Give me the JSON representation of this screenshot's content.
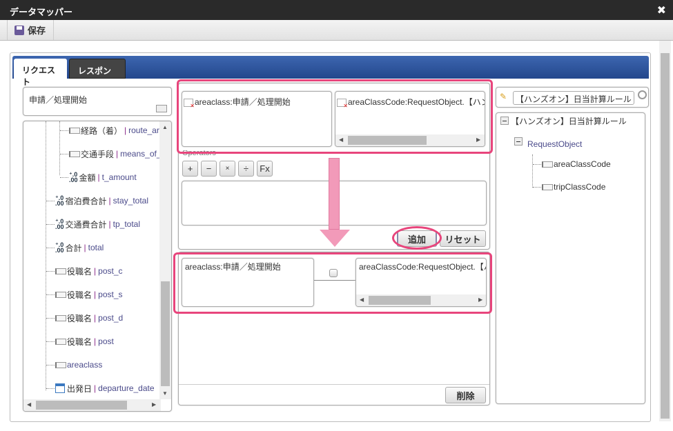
{
  "window": {
    "title": "データマッパー",
    "close_icon": "close-icon"
  },
  "toolbar": {
    "save_label": "保存"
  },
  "tabs": [
    {
      "label": "リクエスト",
      "active": true
    },
    {
      "label": "レスポンス",
      "active": false
    }
  ],
  "left": {
    "search_value": "申請／処理開始",
    "tree": [
      {
        "jp": "経路（着）",
        "en": "route_arrival",
        "icon": "field"
      },
      {
        "jp": "交通手段",
        "en": "means_of_",
        "icon": "field"
      },
      {
        "jp": "金額",
        "en": "t_amount",
        "icon": "number"
      },
      {
        "jp": "宿泊費合計",
        "en": "stay_total",
        "icon": "number"
      },
      {
        "jp": "交通費合計",
        "en": "tp_total",
        "icon": "number"
      },
      {
        "jp": "合計",
        "en": "total",
        "icon": "number"
      },
      {
        "jp": "役職名",
        "en": "post_c",
        "icon": "field"
      },
      {
        "jp": "役職名",
        "en": "post_s",
        "icon": "field"
      },
      {
        "jp": "役職名",
        "en": "post_d",
        "icon": "field"
      },
      {
        "jp": "役職名",
        "en": "post",
        "icon": "field"
      },
      {
        "jp": "",
        "en": "areaclass",
        "icon": "field"
      },
      {
        "jp": "出発日",
        "en": "departure_date",
        "icon": "calendar"
      }
    ]
  },
  "middle": {
    "source_item": "areaclass:申請／処理開始",
    "target_item": "areaClassCode:RequestObject.【ハンズオン】",
    "operators_label": "Operators",
    "operators": [
      "+",
      "−",
      "×",
      "÷",
      "Fx"
    ],
    "expression": "",
    "add_label": "追加",
    "reset_label": "リセット",
    "mapping": {
      "source": "areaclass:申請／処理開始",
      "target": "areaClassCode:RequestObject.【ハンズオン】"
    },
    "delete_label": "削除"
  },
  "right": {
    "search_value": "【ハンズオン】日当計算ルール",
    "tree": {
      "root": "【ハンズオン】日当計算ルール",
      "child": "RequestObject",
      "fields": [
        "areaClassCode",
        "tripClassCode"
      ]
    }
  },
  "colors": {
    "highlight": "#e8457c",
    "tab_bar": "#2f56a0",
    "arrow": "#f08cb0"
  }
}
